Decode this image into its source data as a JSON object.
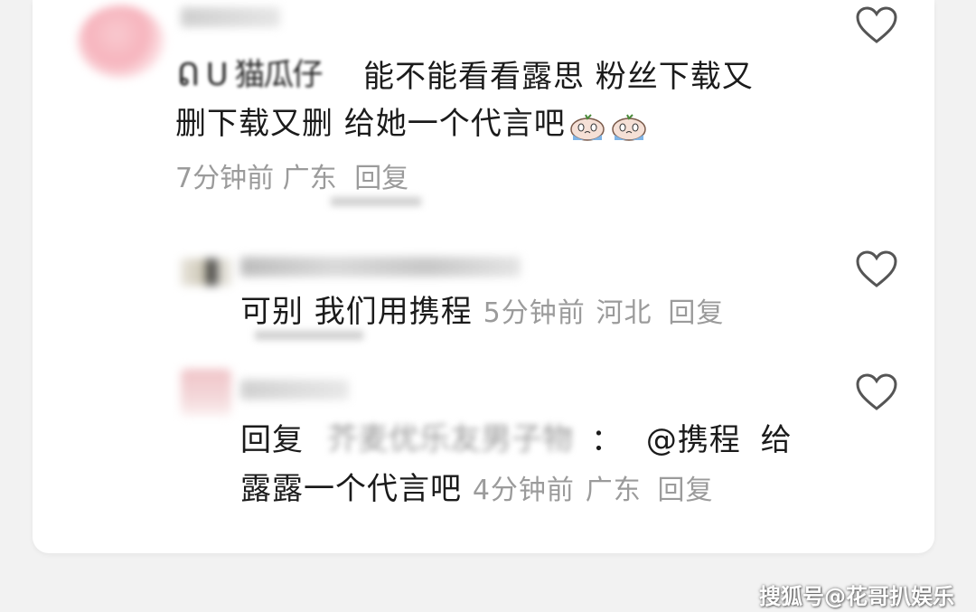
{
  "comment": {
    "text_part1": "能不能看看露思 粉丝下载又",
    "text_part2": "删下载又删 给她一个代言吧",
    "stub_text": "ᕠ ᑌ 猫瓜仔",
    "time": "7分钟前",
    "location": "广东",
    "reply_label": "回复",
    "emoji_name": "crying-face-emoji"
  },
  "replies": [
    {
      "text": "可别  我们用携程",
      "time": "5分钟前",
      "location": "河北",
      "reply_label": "回复"
    },
    {
      "prefix": "回复",
      "mention": "@携程",
      "text_after": "给",
      "text_line2": "露露一个代言吧",
      "colon": "：",
      "time": "4分钟前",
      "location": "广东",
      "reply_label": "回复"
    }
  ],
  "icons": {
    "like": "heart-outline-icon"
  },
  "watermark": "搜狐号@花哥扒娱乐",
  "colors": {
    "text": "#1b1b1b",
    "meta": "#9b9b9b",
    "heart": "#555555"
  }
}
